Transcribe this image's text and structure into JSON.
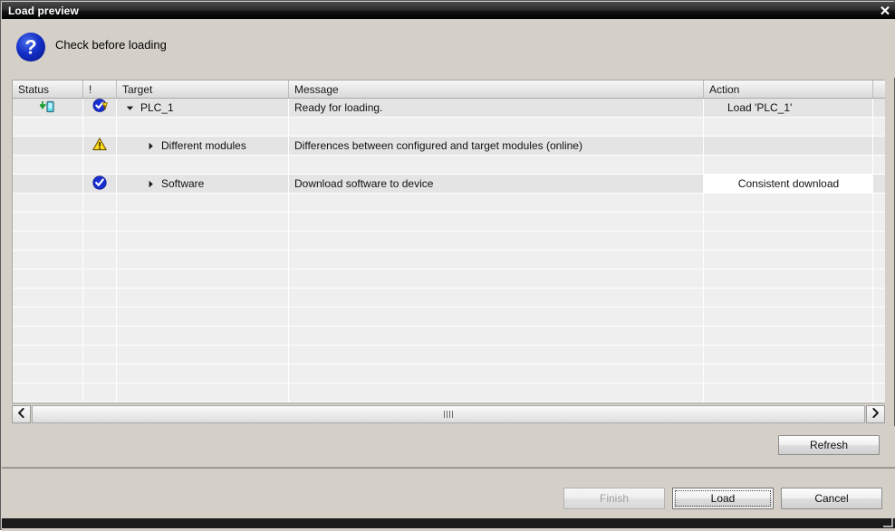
{
  "window": {
    "title": "Load preview",
    "close_icon": "close-icon"
  },
  "header": {
    "icon": "question-circle-icon",
    "label": "Check before loading"
  },
  "table": {
    "columns": [
      {
        "key": "status",
        "label": "Status"
      },
      {
        "key": "warning",
        "label": "!"
      },
      {
        "key": "target",
        "label": "Target"
      },
      {
        "key": "message",
        "label": "Message"
      },
      {
        "key": "action",
        "label": "Action"
      },
      {
        "key": "spacer",
        "label": ""
      }
    ],
    "rows": [
      {
        "status_icon": "download-to-device-icon",
        "warning_icon": "check-circle-warning-icon",
        "twisty": "chevron-down-icon",
        "target": "PLC_1",
        "message": "Ready for loading.",
        "action": "Load 'PLC_1'",
        "action_is_field": false
      },
      {
        "status_icon": "",
        "warning_icon": "warning-triangle-icon",
        "twisty": "chevron-right-icon",
        "target": "Different modules",
        "message": "Differences between configured and target modules (online)",
        "action": "",
        "action_is_field": false
      },
      {
        "status_icon": "",
        "warning_icon": "check-circle-icon",
        "twisty": "chevron-right-icon",
        "target": "Software",
        "message": "Download software to device",
        "action": "Consistent download",
        "action_is_field": true
      }
    ]
  },
  "scrollbar": {
    "left_icon": "chevron-left-icon",
    "right_icon": "chevron-right-icon",
    "grip_icon": "scrollbar-grip-icon"
  },
  "buttons": {
    "refresh": "Refresh",
    "finish": "Finish",
    "load": "Load",
    "cancel": "Cancel"
  },
  "colors": {
    "dialog_face": "#d4d0c8",
    "titlebar": "#000000",
    "row_shade_a": "#e4e4e4",
    "row_shade_b": "#efefef",
    "accent_blue": "#1a3fd4",
    "warning_yellow": "#ffd91a",
    "status_green": "#1f9d35",
    "status_cyan": "#3fd2e8"
  }
}
